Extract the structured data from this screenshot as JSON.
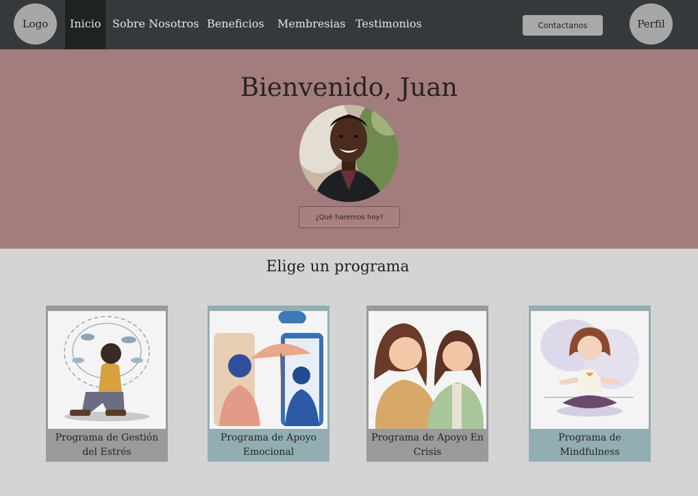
{
  "nav": {
    "logo": "Logo",
    "links": [
      "Inicio",
      "Sobre Nosotros",
      "Beneficios",
      "Membresias",
      "Testimonios"
    ],
    "contact_label": "Contactanos",
    "profile": "Perfil",
    "active": "Inicio"
  },
  "hero": {
    "title": "Bienvenido, Juan",
    "button_label": "¿Qué haremos hoy?"
  },
  "programs": {
    "title": "Elige un programa",
    "cards": [
      {
        "label": "Programa de Gestión del Estrés"
      },
      {
        "label": "Programa de Apoyo Emocional"
      },
      {
        "label": "Programa de Apoyo En Crisis"
      },
      {
        "label": "Programa de Mindfulness"
      }
    ]
  },
  "colors": {
    "nav_bg": "#343a3b",
    "hero_bg": "#a37c7d",
    "page_bg": "#d4d4d4"
  }
}
